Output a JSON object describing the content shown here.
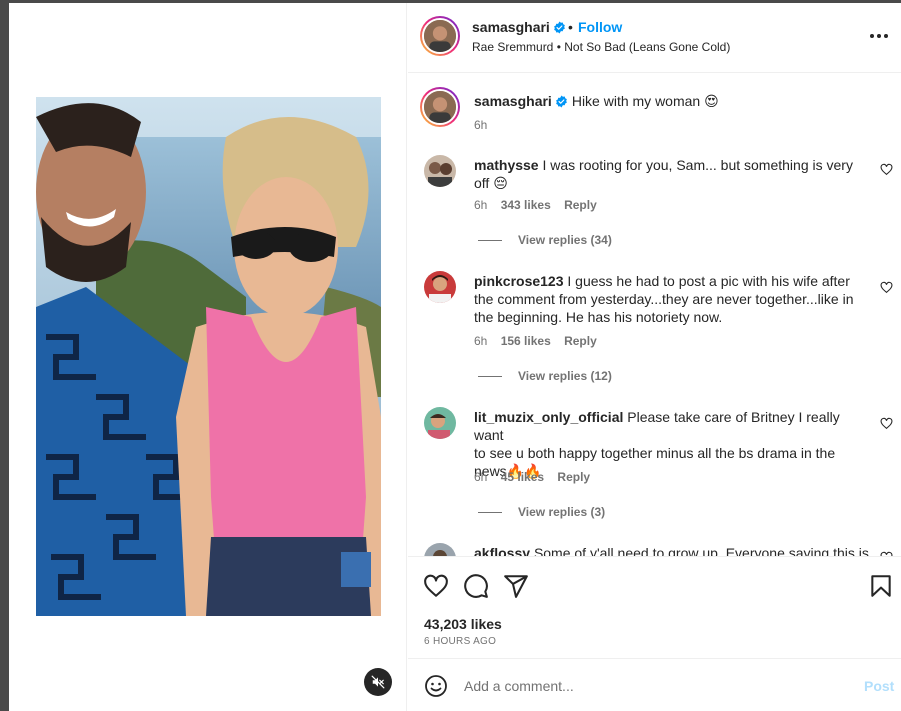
{
  "header": {
    "username": "samasghari",
    "follow_label": "Follow",
    "separator": "•",
    "audio": "Rae Sremmurd • Not So Bad (Leans Gone Cold)"
  },
  "caption": {
    "username": "samasghari",
    "text": "Hike with my woman 😍",
    "time": "6h"
  },
  "comments": [
    {
      "username": "mathysse",
      "line1": "I was rooting for you, Sam... but something is very",
      "line2": "off 😔",
      "line3": "",
      "time": "6h",
      "likes": "343 likes",
      "reply": "Reply",
      "view_replies": "View replies (34)"
    },
    {
      "username": "pinkcrose123",
      "line1": "I guess he had to post a pic with his wife after",
      "line2": "the comment from yesterday...they are never together...like in",
      "line3": "the beginning. He has his notoriety now.",
      "time": "6h",
      "likes": "156 likes",
      "reply": "Reply",
      "view_replies": "View replies (12)"
    },
    {
      "username": "lit_muzix_only_official",
      "line1": "Please take care of Britney I really want",
      "line2": "to see u both happy together minus all the bs drama in the",
      "line3": "news🔥🔥",
      "time": "6h",
      "likes": "45 likes",
      "reply": "Reply",
      "view_replies": "View replies (3)"
    },
    {
      "username": "akflossy",
      "line1": "Some of y'all need to grow up. Everyone saying this is",
      "line2": "",
      "line3": ""
    }
  ],
  "actions": {
    "likes": "43,203 likes",
    "time_ago": "6 HOURS AGO"
  },
  "add_comment": {
    "placeholder": "Add a comment...",
    "post_label": "Post"
  },
  "colors": {
    "accent": "#0095f6",
    "post_disabled": "#b2dffc",
    "secondary_text": "#737373"
  },
  "icons": [
    "verified-badge-icon",
    "more-options-icon",
    "heart-icon",
    "comment-icon",
    "share-icon",
    "bookmark-icon",
    "emoji-icon",
    "mute-icon"
  ]
}
